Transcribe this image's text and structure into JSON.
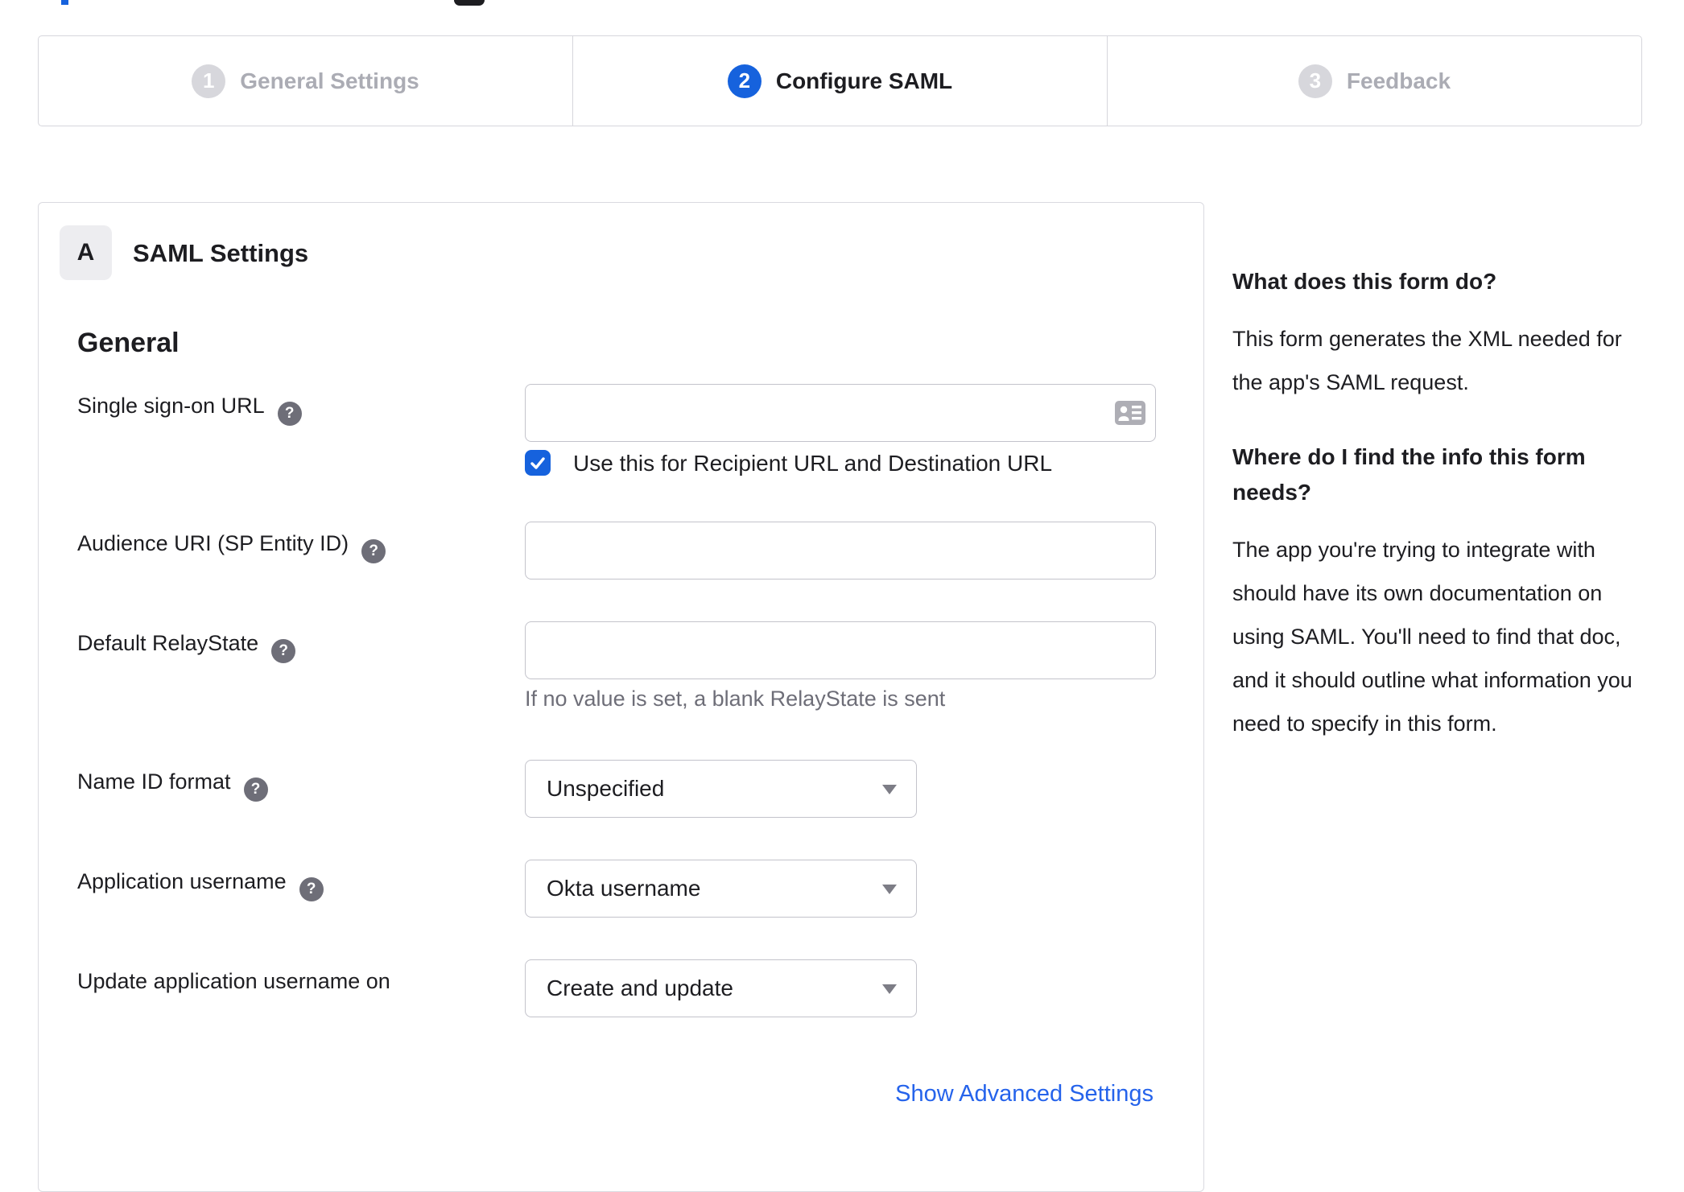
{
  "colors": {
    "accent": "#1662dd",
    "link": "#2563eb",
    "inactive_step_circle": "#d7d7dc",
    "inactive_step_text": "#abacb4",
    "text": "#1d1d21",
    "muted": "#6e6e78",
    "input_border": "#c3c3cb"
  },
  "icons": {
    "help_glyph": "?",
    "contact_card": "contact-card",
    "dropdown_arrow": "caret-down",
    "checkmark": "check"
  },
  "stepper": {
    "steps": [
      {
        "number": "1",
        "label": "General Settings",
        "state": "inactive"
      },
      {
        "number": "2",
        "label": "Configure SAML",
        "state": "active"
      },
      {
        "number": "3",
        "label": "Feedback",
        "state": "inactive"
      }
    ]
  },
  "panel": {
    "badge": "A",
    "title": "SAML Settings",
    "section_heading": "General",
    "fields": [
      {
        "label": "Single sign-on URL",
        "has_help": true,
        "value": "",
        "checkbox": {
          "checked": true,
          "label": "Use this for Recipient URL and Destination URL"
        }
      },
      {
        "label": "Audience URI (SP Entity ID)",
        "has_help": true,
        "value": ""
      },
      {
        "label": "Default RelayState",
        "has_help": true,
        "value": "",
        "helper": "If no value is set, a blank RelayState is sent"
      },
      {
        "label": "Name ID format",
        "has_help": true,
        "selected": "Unspecified"
      },
      {
        "label": "Application username",
        "has_help": true,
        "selected": "Okta username"
      },
      {
        "label": "Update application username on",
        "has_help": false,
        "selected": "Create and update"
      }
    ],
    "advanced_link": "Show Advanced Settings"
  },
  "sidebar": {
    "sections": [
      {
        "heading": "What does this form do?",
        "body": "This form generates the XML needed for the app's SAML request."
      },
      {
        "heading": "Where do I find the info this form needs?",
        "body": "The app you're trying to integrate with should have its own documentation on using SAML. You'll need to find that doc, and it should outline what information you need to specify in this form."
      }
    ]
  }
}
